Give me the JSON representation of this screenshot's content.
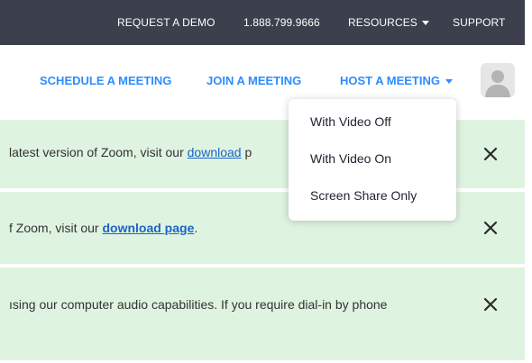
{
  "topbar": {
    "request_demo": "REQUEST A DEMO",
    "phone": "1.888.799.9666",
    "resources": "RESOURCES",
    "support": "SUPPORT"
  },
  "nav": {
    "schedule": "SCHEDULE A MEETING",
    "join": "JOIN A MEETING",
    "host": "HOST A MEETING"
  },
  "host_menu": {
    "options": [
      "With Video Off",
      "With Video On",
      "Screen Share Only"
    ]
  },
  "banners": [
    {
      "before": "latest version of Zoom, visit our ",
      "link": "download",
      "after": " p"
    },
    {
      "before": "f Zoom, visit our ",
      "link": "download page",
      "after": "."
    },
    {
      "text": "ısing our computer audio capabilities. If you require dial-in by phone"
    }
  ],
  "colors": {
    "topbar_bg": "#3c3f4c",
    "accent": "#2d8cff",
    "banner_bg": "#dff3e1",
    "link": "#1a65c9"
  },
  "icons": {
    "close": "close-icon",
    "avatar": "avatar-icon",
    "caret": "caret-down-icon"
  }
}
